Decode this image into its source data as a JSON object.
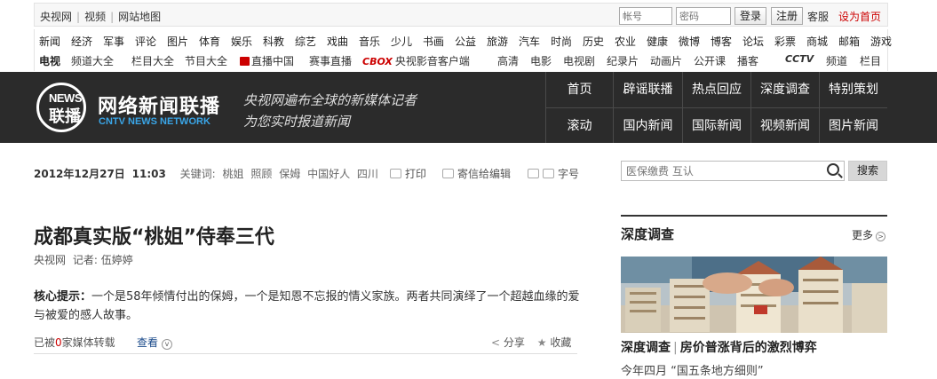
{
  "topbar": {
    "links": [
      "央视网",
      "视频",
      "网站地图"
    ],
    "account_placeholder": "帐号",
    "password_placeholder": "密码",
    "login": "登录",
    "register": "注册",
    "service": "客服",
    "set_home": "设为首页"
  },
  "nav_row1": [
    "新闻",
    "经济",
    "军事",
    "评论",
    "图片",
    "体育",
    "娱乐",
    "科教",
    "综艺",
    "戏曲",
    "音乐",
    "少儿",
    "书画",
    "公益",
    "旅游",
    "汽车",
    "时尚",
    "历史",
    "农业",
    "健康",
    "微博",
    "博客",
    "论坛",
    "彩票",
    "商城",
    "邮箱",
    "游戏"
  ],
  "nav_row2": {
    "tv_label": "电视",
    "channels": "频道大全",
    "columns": "栏目大全",
    "programs": "节目大全",
    "live_china": "直播中国",
    "events_live": "赛事直播",
    "cbox": "CBOX",
    "client": "央视影音客户端",
    "hd": "高清",
    "movie": "电影",
    "drama": "电视剧",
    "doc": "纪录片",
    "anime": "动画片",
    "opencourse": "公开课",
    "podcast": "播客",
    "cctv": "CCTV",
    "channel": "频道",
    "column": "栏目"
  },
  "banner": {
    "logo_news": "NEWS",
    "logo_lb": "联播",
    "title": "网络新闻联播",
    "subtitle_en": "CNTV NEWS NETWORK",
    "slogan_line1": "央视网遍布全球的新媒体记者",
    "slogan_line2": "为您实时报道新闻",
    "menu_row1": [
      "首页",
      "辟谣联播",
      "热点回应",
      "深度调查",
      "特别策划"
    ],
    "menu_row2": [
      "滚动",
      "国内新闻",
      "国际新闻",
      "视频新闻",
      "图片新闻"
    ]
  },
  "article": {
    "date": "2012年12月27日",
    "time": "11:03",
    "keywords_label": "关键词:",
    "keywords": [
      "桃姐",
      "照顾",
      "保姆",
      "中国好人",
      "四川"
    ],
    "print": "打印",
    "send_editor": "寄信给编辑",
    "font_size": "字号",
    "headline": "成都真实版“桃姐”侍奉三代",
    "source": "央视网",
    "reporter": "记者: 伍婷婷",
    "summary_label": "核心提示：",
    "summary": "一个是58年倾情付出的保姆，一个是知恩不忘报的情义家族。两者共同演绎了一个超越血缘的爱与被爱的感人故事。",
    "reprint_prefix": "已被",
    "reprint_count": "0",
    "reprint_suffix": "家媒体转载",
    "view": "查看",
    "share": "分享",
    "favorite": "收藏"
  },
  "sidebar": {
    "search_placeholder": "医保缴费 互认",
    "search_button": "搜索",
    "section_title": "深度调查",
    "more": "更多",
    "caption_tag": "深度调查",
    "caption_title": "房价普涨背后的激烈博弈",
    "teaser": "今年四月 “国五条地方细则”"
  }
}
